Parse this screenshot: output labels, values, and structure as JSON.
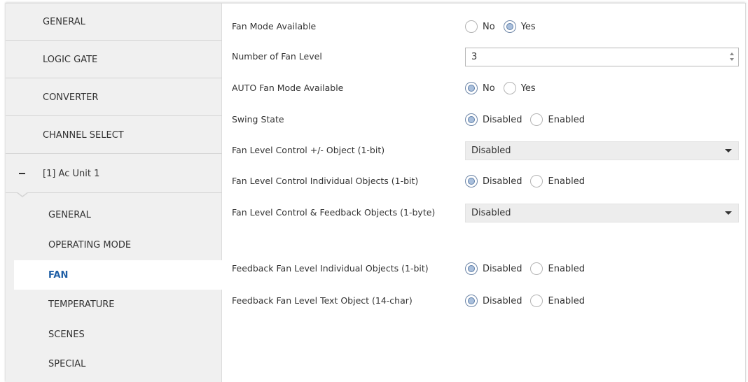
{
  "sidebar": {
    "top_items": [
      "GENERAL",
      "LOGIC GATE",
      "CONVERTER",
      "CHANNEL SELECT"
    ],
    "group": {
      "label": "[1] Ac Unit 1",
      "icon": "collapse-minus-icon"
    },
    "sub_items": [
      "GENERAL",
      "OPERATING MODE",
      "FAN",
      "TEMPERATURE",
      "SCENES",
      "SPECIAL"
    ],
    "active_sub_item": "FAN"
  },
  "params": {
    "fan_mode_available": {
      "label": "Fan Mode Available",
      "options": [
        "No",
        "Yes"
      ],
      "selected": "Yes"
    },
    "number_of_fan_level": {
      "label": "Number of Fan Level",
      "value": "3"
    },
    "auto_fan_mode_available": {
      "label": "AUTO Fan Mode Available",
      "options": [
        "No",
        "Yes"
      ],
      "selected": "No"
    },
    "swing_state": {
      "label": "Swing State",
      "options": [
        "Disabled",
        "Enabled"
      ],
      "selected": "Disabled"
    },
    "fan_level_control_plus_minus": {
      "label": "Fan Level Control +/- Object (1-bit)",
      "value": "Disabled"
    },
    "fan_level_control_individual": {
      "label": "Fan Level Control Individual Objects (1-bit)",
      "options": [
        "Disabled",
        "Enabled"
      ],
      "selected": "Disabled"
    },
    "fan_level_control_feedback_1byte": {
      "label": "Fan Level Control & Feedback Objects (1-byte)",
      "value": "Disabled"
    },
    "feedback_fan_level_individual": {
      "label": "Feedback Fan Level Individual Objects (1-bit)",
      "options": [
        "Disabled",
        "Enabled"
      ],
      "selected": "Disabled"
    },
    "feedback_fan_level_text": {
      "label": "Feedback Fan Level Text Object (14-char)",
      "options": [
        "Disabled",
        "Enabled"
      ],
      "selected": "Disabled"
    }
  },
  "colors": {
    "active_text": "#1f5fa6",
    "sidebar_bg": "#f0f0f0",
    "radio_checked": "#a9bfdc"
  }
}
